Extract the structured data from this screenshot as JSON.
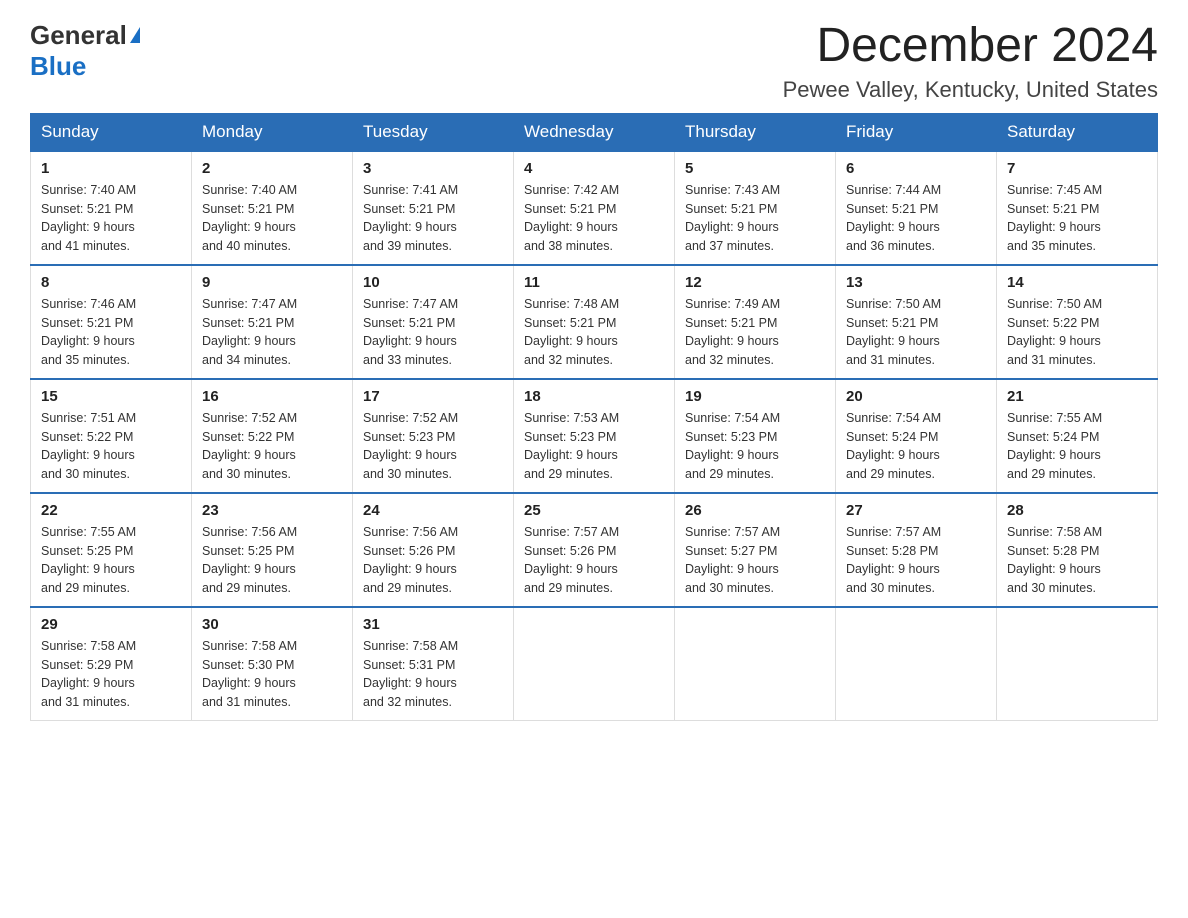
{
  "header": {
    "logo_general": "General",
    "logo_blue": "Blue",
    "title": "December 2024",
    "subtitle": "Pewee Valley, Kentucky, United States"
  },
  "days_of_week": [
    "Sunday",
    "Monday",
    "Tuesday",
    "Wednesday",
    "Thursday",
    "Friday",
    "Saturday"
  ],
  "weeks": [
    [
      {
        "day": "1",
        "sunrise": "7:40 AM",
        "sunset": "5:21 PM",
        "daylight": "9 hours and 41 minutes."
      },
      {
        "day": "2",
        "sunrise": "7:40 AM",
        "sunset": "5:21 PM",
        "daylight": "9 hours and 40 minutes."
      },
      {
        "day": "3",
        "sunrise": "7:41 AM",
        "sunset": "5:21 PM",
        "daylight": "9 hours and 39 minutes."
      },
      {
        "day": "4",
        "sunrise": "7:42 AM",
        "sunset": "5:21 PM",
        "daylight": "9 hours and 38 minutes."
      },
      {
        "day": "5",
        "sunrise": "7:43 AM",
        "sunset": "5:21 PM",
        "daylight": "9 hours and 37 minutes."
      },
      {
        "day": "6",
        "sunrise": "7:44 AM",
        "sunset": "5:21 PM",
        "daylight": "9 hours and 36 minutes."
      },
      {
        "day": "7",
        "sunrise": "7:45 AM",
        "sunset": "5:21 PM",
        "daylight": "9 hours and 35 minutes."
      }
    ],
    [
      {
        "day": "8",
        "sunrise": "7:46 AM",
        "sunset": "5:21 PM",
        "daylight": "9 hours and 35 minutes."
      },
      {
        "day": "9",
        "sunrise": "7:47 AM",
        "sunset": "5:21 PM",
        "daylight": "9 hours and 34 minutes."
      },
      {
        "day": "10",
        "sunrise": "7:47 AM",
        "sunset": "5:21 PM",
        "daylight": "9 hours and 33 minutes."
      },
      {
        "day": "11",
        "sunrise": "7:48 AM",
        "sunset": "5:21 PM",
        "daylight": "9 hours and 32 minutes."
      },
      {
        "day": "12",
        "sunrise": "7:49 AM",
        "sunset": "5:21 PM",
        "daylight": "9 hours and 32 minutes."
      },
      {
        "day": "13",
        "sunrise": "7:50 AM",
        "sunset": "5:21 PM",
        "daylight": "9 hours and 31 minutes."
      },
      {
        "day": "14",
        "sunrise": "7:50 AM",
        "sunset": "5:22 PM",
        "daylight": "9 hours and 31 minutes."
      }
    ],
    [
      {
        "day": "15",
        "sunrise": "7:51 AM",
        "sunset": "5:22 PM",
        "daylight": "9 hours and 30 minutes."
      },
      {
        "day": "16",
        "sunrise": "7:52 AM",
        "sunset": "5:22 PM",
        "daylight": "9 hours and 30 minutes."
      },
      {
        "day": "17",
        "sunrise": "7:52 AM",
        "sunset": "5:23 PM",
        "daylight": "9 hours and 30 minutes."
      },
      {
        "day": "18",
        "sunrise": "7:53 AM",
        "sunset": "5:23 PM",
        "daylight": "9 hours and 29 minutes."
      },
      {
        "day": "19",
        "sunrise": "7:54 AM",
        "sunset": "5:23 PM",
        "daylight": "9 hours and 29 minutes."
      },
      {
        "day": "20",
        "sunrise": "7:54 AM",
        "sunset": "5:24 PM",
        "daylight": "9 hours and 29 minutes."
      },
      {
        "day": "21",
        "sunrise": "7:55 AM",
        "sunset": "5:24 PM",
        "daylight": "9 hours and 29 minutes."
      }
    ],
    [
      {
        "day": "22",
        "sunrise": "7:55 AM",
        "sunset": "5:25 PM",
        "daylight": "9 hours and 29 minutes."
      },
      {
        "day": "23",
        "sunrise": "7:56 AM",
        "sunset": "5:25 PM",
        "daylight": "9 hours and 29 minutes."
      },
      {
        "day": "24",
        "sunrise": "7:56 AM",
        "sunset": "5:26 PM",
        "daylight": "9 hours and 29 minutes."
      },
      {
        "day": "25",
        "sunrise": "7:57 AM",
        "sunset": "5:26 PM",
        "daylight": "9 hours and 29 minutes."
      },
      {
        "day": "26",
        "sunrise": "7:57 AM",
        "sunset": "5:27 PM",
        "daylight": "9 hours and 30 minutes."
      },
      {
        "day": "27",
        "sunrise": "7:57 AM",
        "sunset": "5:28 PM",
        "daylight": "9 hours and 30 minutes."
      },
      {
        "day": "28",
        "sunrise": "7:58 AM",
        "sunset": "5:28 PM",
        "daylight": "9 hours and 30 minutes."
      }
    ],
    [
      {
        "day": "29",
        "sunrise": "7:58 AM",
        "sunset": "5:29 PM",
        "daylight": "9 hours and 31 minutes."
      },
      {
        "day": "30",
        "sunrise": "7:58 AM",
        "sunset": "5:30 PM",
        "daylight": "9 hours and 31 minutes."
      },
      {
        "day": "31",
        "sunrise": "7:58 AM",
        "sunset": "5:31 PM",
        "daylight": "9 hours and 32 minutes."
      },
      null,
      null,
      null,
      null
    ]
  ]
}
